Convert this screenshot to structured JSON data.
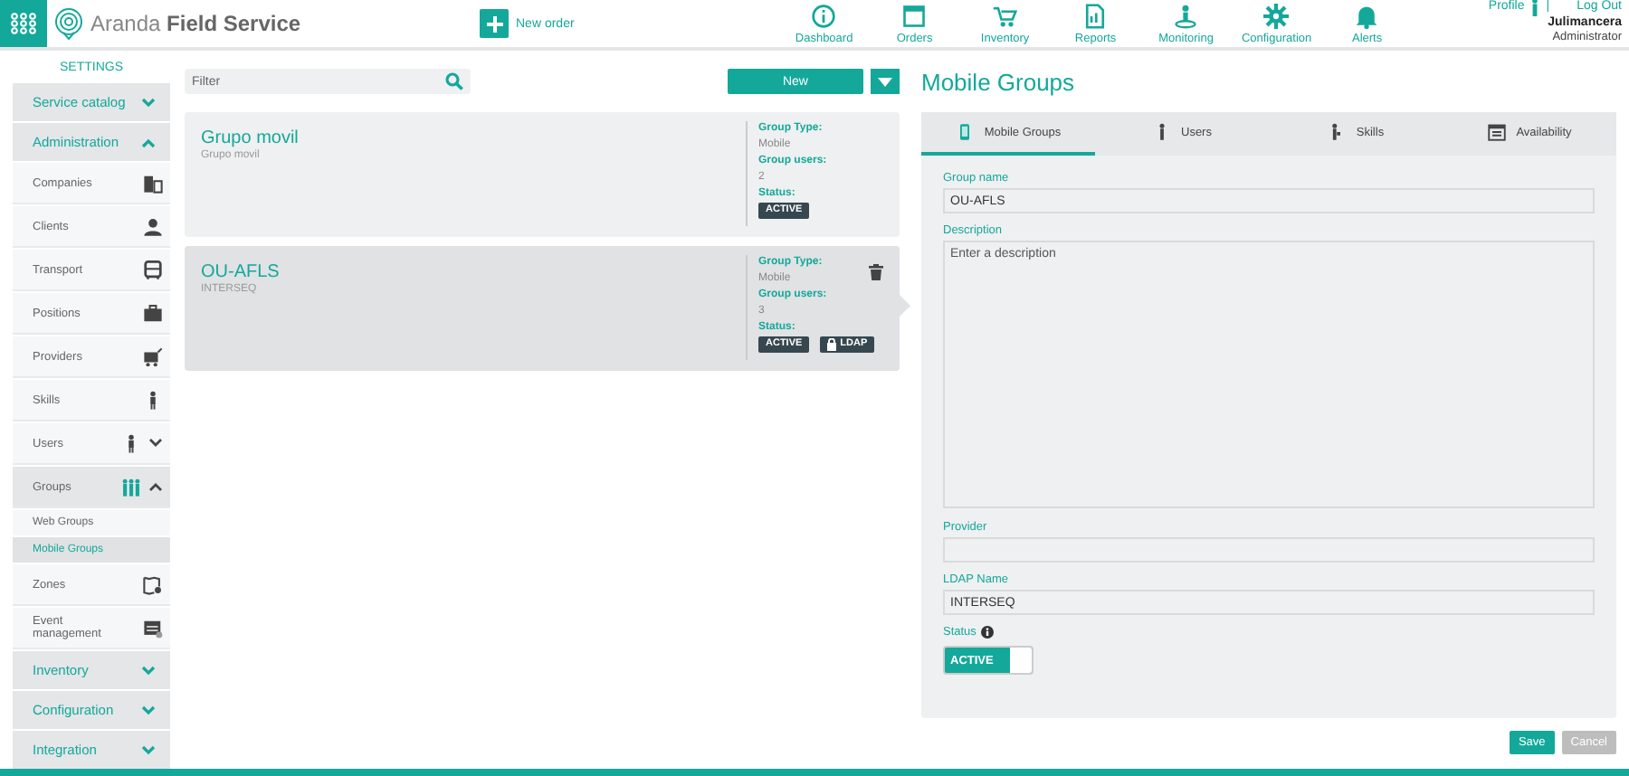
{
  "header": {
    "brand": "Aranda **Field Service**",
    "new_order": "New order",
    "nav": [
      {
        "label": "Dashboard"
      },
      {
        "label": "Orders"
      },
      {
        "label": "Inventory"
      },
      {
        "label": "Reports"
      },
      {
        "label": "Monitoring"
      },
      {
        "label": "Configuration"
      },
      {
        "label": "Alerts"
      }
    ],
    "profile": "Profile",
    "separator": "|",
    "logout": "Log Out",
    "user": "Julimancera",
    "role": "Administrator"
  },
  "sidebar": {
    "title": "SETTINGS",
    "sections": [
      {
        "label": "Service catalog",
        "expanded": false
      },
      {
        "label": "Administration",
        "expanded": true,
        "children": [
          {
            "label": "Companies",
            "selected": false
          },
          {
            "label": "Clients",
            "selected": false
          },
          {
            "label": "Transport",
            "selected": false
          },
          {
            "label": "Positions",
            "selected": false
          },
          {
            "label": "Providers",
            "selected": false
          },
          {
            "label": "Skills",
            "selected": false
          },
          {
            "label": "Users",
            "selected": false,
            "expanded": false
          },
          {
            "label": "Groups",
            "selected": false,
            "expanded": true,
            "children": [
              {
                "label": "Web Groups",
                "selected": false
              },
              {
                "label": "Mobile Groups",
                "selected": true
              }
            ]
          },
          {
            "label": "Zones",
            "selected": false
          },
          {
            "label": "Event management",
            "selected": false
          }
        ]
      },
      {
        "label": "Inventory",
        "expanded": false
      },
      {
        "label": "Configuration",
        "expanded": false
      },
      {
        "label": "Integration",
        "expanded": false
      }
    ]
  },
  "list": {
    "filter_placeholder": "Filter",
    "new_button": "New",
    "cards": [
      {
        "title": "Grupo movil",
        "subtitle": "Grupo movil",
        "selected": false,
        "fields": [
          {
            "label": "Group Type:",
            "value": "Mobile"
          },
          {
            "label": "Group users:",
            "value": "2"
          }
        ],
        "status_label": "Status:",
        "badges": [
          {
            "kind": "status",
            "text": "ACTIVE"
          }
        ]
      },
      {
        "title": "OU-AFLS",
        "subtitle": "INTERSEQ",
        "selected": true,
        "fields": [
          {
            "label": "Group Type:",
            "value": "Mobile"
          },
          {
            "label": "Group users:",
            "value": "3"
          }
        ],
        "status_label": "Status:",
        "badges": [
          {
            "kind": "status",
            "text": "ACTIVE"
          },
          {
            "kind": "ldap",
            "text": "LDAP"
          }
        ]
      }
    ]
  },
  "detail": {
    "title": "Mobile Groups",
    "tabs": [
      {
        "label": "Mobile Groups",
        "selected": true
      },
      {
        "label": "Users",
        "selected": false
      },
      {
        "label": "Skills",
        "selected": false
      },
      {
        "label": "Availability",
        "selected": false
      }
    ],
    "fields": [
      {
        "kind": "input",
        "label": "Group name",
        "value": "OU-AFLS"
      },
      {
        "kind": "textarea",
        "label": "Description",
        "placeholder": "Enter a description"
      },
      {
        "kind": "input",
        "label": "Provider"
      },
      {
        "kind": "input",
        "label": "LDAP Name",
        "value": "INTERSEQ"
      }
    ],
    "status": {
      "label": "Status",
      "on": true,
      "text": "ACTIVE"
    },
    "buttons": [
      {
        "kind": "primary",
        "label": "Save"
      },
      {
        "kind": "secondary",
        "label": "Cancel"
      }
    ]
  }
}
